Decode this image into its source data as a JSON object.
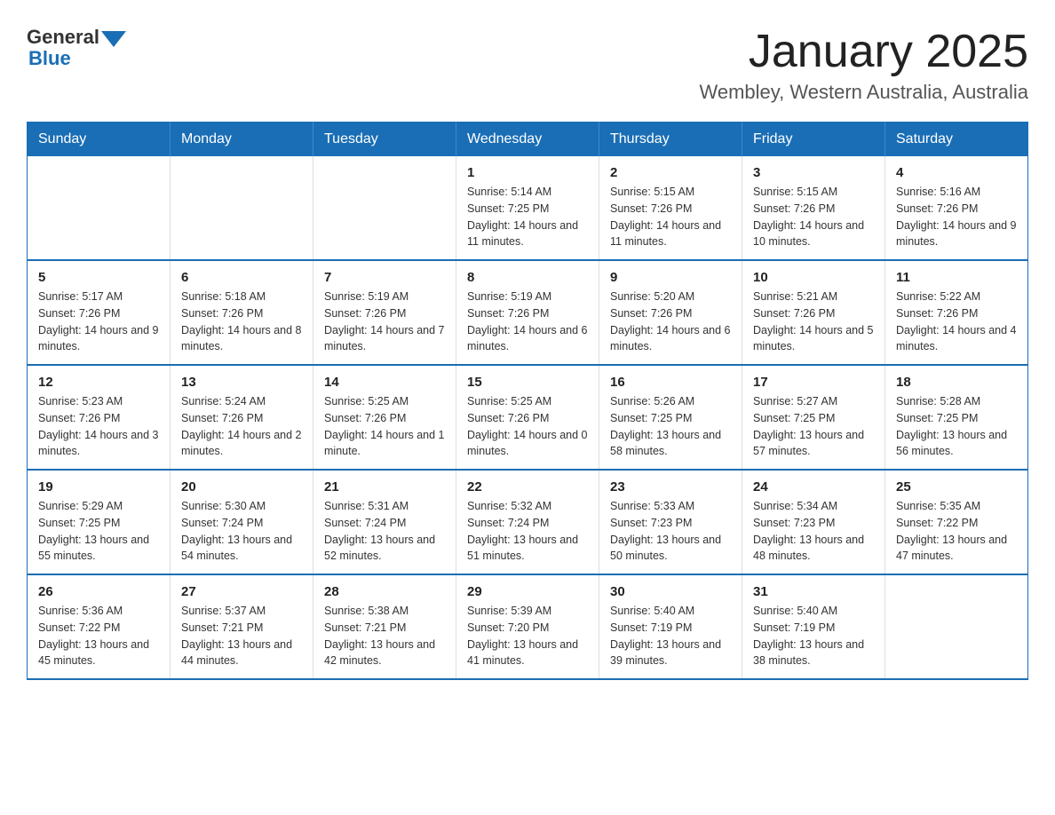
{
  "header": {
    "logo_text_general": "General",
    "logo_text_blue": "Blue",
    "main_title": "January 2025",
    "subtitle": "Wembley, Western Australia, Australia"
  },
  "days_of_week": [
    "Sunday",
    "Monday",
    "Tuesday",
    "Wednesday",
    "Thursday",
    "Friday",
    "Saturday"
  ],
  "weeks": [
    [
      {
        "day": "",
        "info": ""
      },
      {
        "day": "",
        "info": ""
      },
      {
        "day": "",
        "info": ""
      },
      {
        "day": "1",
        "info": "Sunrise: 5:14 AM\nSunset: 7:25 PM\nDaylight: 14 hours and 11 minutes."
      },
      {
        "day": "2",
        "info": "Sunrise: 5:15 AM\nSunset: 7:26 PM\nDaylight: 14 hours and 11 minutes."
      },
      {
        "day": "3",
        "info": "Sunrise: 5:15 AM\nSunset: 7:26 PM\nDaylight: 14 hours and 10 minutes."
      },
      {
        "day": "4",
        "info": "Sunrise: 5:16 AM\nSunset: 7:26 PM\nDaylight: 14 hours and 9 minutes."
      }
    ],
    [
      {
        "day": "5",
        "info": "Sunrise: 5:17 AM\nSunset: 7:26 PM\nDaylight: 14 hours and 9 minutes."
      },
      {
        "day": "6",
        "info": "Sunrise: 5:18 AM\nSunset: 7:26 PM\nDaylight: 14 hours and 8 minutes."
      },
      {
        "day": "7",
        "info": "Sunrise: 5:19 AM\nSunset: 7:26 PM\nDaylight: 14 hours and 7 minutes."
      },
      {
        "day": "8",
        "info": "Sunrise: 5:19 AM\nSunset: 7:26 PM\nDaylight: 14 hours and 6 minutes."
      },
      {
        "day": "9",
        "info": "Sunrise: 5:20 AM\nSunset: 7:26 PM\nDaylight: 14 hours and 6 minutes."
      },
      {
        "day": "10",
        "info": "Sunrise: 5:21 AM\nSunset: 7:26 PM\nDaylight: 14 hours and 5 minutes."
      },
      {
        "day": "11",
        "info": "Sunrise: 5:22 AM\nSunset: 7:26 PM\nDaylight: 14 hours and 4 minutes."
      }
    ],
    [
      {
        "day": "12",
        "info": "Sunrise: 5:23 AM\nSunset: 7:26 PM\nDaylight: 14 hours and 3 minutes."
      },
      {
        "day": "13",
        "info": "Sunrise: 5:24 AM\nSunset: 7:26 PM\nDaylight: 14 hours and 2 minutes."
      },
      {
        "day": "14",
        "info": "Sunrise: 5:25 AM\nSunset: 7:26 PM\nDaylight: 14 hours and 1 minute."
      },
      {
        "day": "15",
        "info": "Sunrise: 5:25 AM\nSunset: 7:26 PM\nDaylight: 14 hours and 0 minutes."
      },
      {
        "day": "16",
        "info": "Sunrise: 5:26 AM\nSunset: 7:25 PM\nDaylight: 13 hours and 58 minutes."
      },
      {
        "day": "17",
        "info": "Sunrise: 5:27 AM\nSunset: 7:25 PM\nDaylight: 13 hours and 57 minutes."
      },
      {
        "day": "18",
        "info": "Sunrise: 5:28 AM\nSunset: 7:25 PM\nDaylight: 13 hours and 56 minutes."
      }
    ],
    [
      {
        "day": "19",
        "info": "Sunrise: 5:29 AM\nSunset: 7:25 PM\nDaylight: 13 hours and 55 minutes."
      },
      {
        "day": "20",
        "info": "Sunrise: 5:30 AM\nSunset: 7:24 PM\nDaylight: 13 hours and 54 minutes."
      },
      {
        "day": "21",
        "info": "Sunrise: 5:31 AM\nSunset: 7:24 PM\nDaylight: 13 hours and 52 minutes."
      },
      {
        "day": "22",
        "info": "Sunrise: 5:32 AM\nSunset: 7:24 PM\nDaylight: 13 hours and 51 minutes."
      },
      {
        "day": "23",
        "info": "Sunrise: 5:33 AM\nSunset: 7:23 PM\nDaylight: 13 hours and 50 minutes."
      },
      {
        "day": "24",
        "info": "Sunrise: 5:34 AM\nSunset: 7:23 PM\nDaylight: 13 hours and 48 minutes."
      },
      {
        "day": "25",
        "info": "Sunrise: 5:35 AM\nSunset: 7:22 PM\nDaylight: 13 hours and 47 minutes."
      }
    ],
    [
      {
        "day": "26",
        "info": "Sunrise: 5:36 AM\nSunset: 7:22 PM\nDaylight: 13 hours and 45 minutes."
      },
      {
        "day": "27",
        "info": "Sunrise: 5:37 AM\nSunset: 7:21 PM\nDaylight: 13 hours and 44 minutes."
      },
      {
        "day": "28",
        "info": "Sunrise: 5:38 AM\nSunset: 7:21 PM\nDaylight: 13 hours and 42 minutes."
      },
      {
        "day": "29",
        "info": "Sunrise: 5:39 AM\nSunset: 7:20 PM\nDaylight: 13 hours and 41 minutes."
      },
      {
        "day": "30",
        "info": "Sunrise: 5:40 AM\nSunset: 7:19 PM\nDaylight: 13 hours and 39 minutes."
      },
      {
        "day": "31",
        "info": "Sunrise: 5:40 AM\nSunset: 7:19 PM\nDaylight: 13 hours and 38 minutes."
      },
      {
        "day": "",
        "info": ""
      }
    ]
  ]
}
